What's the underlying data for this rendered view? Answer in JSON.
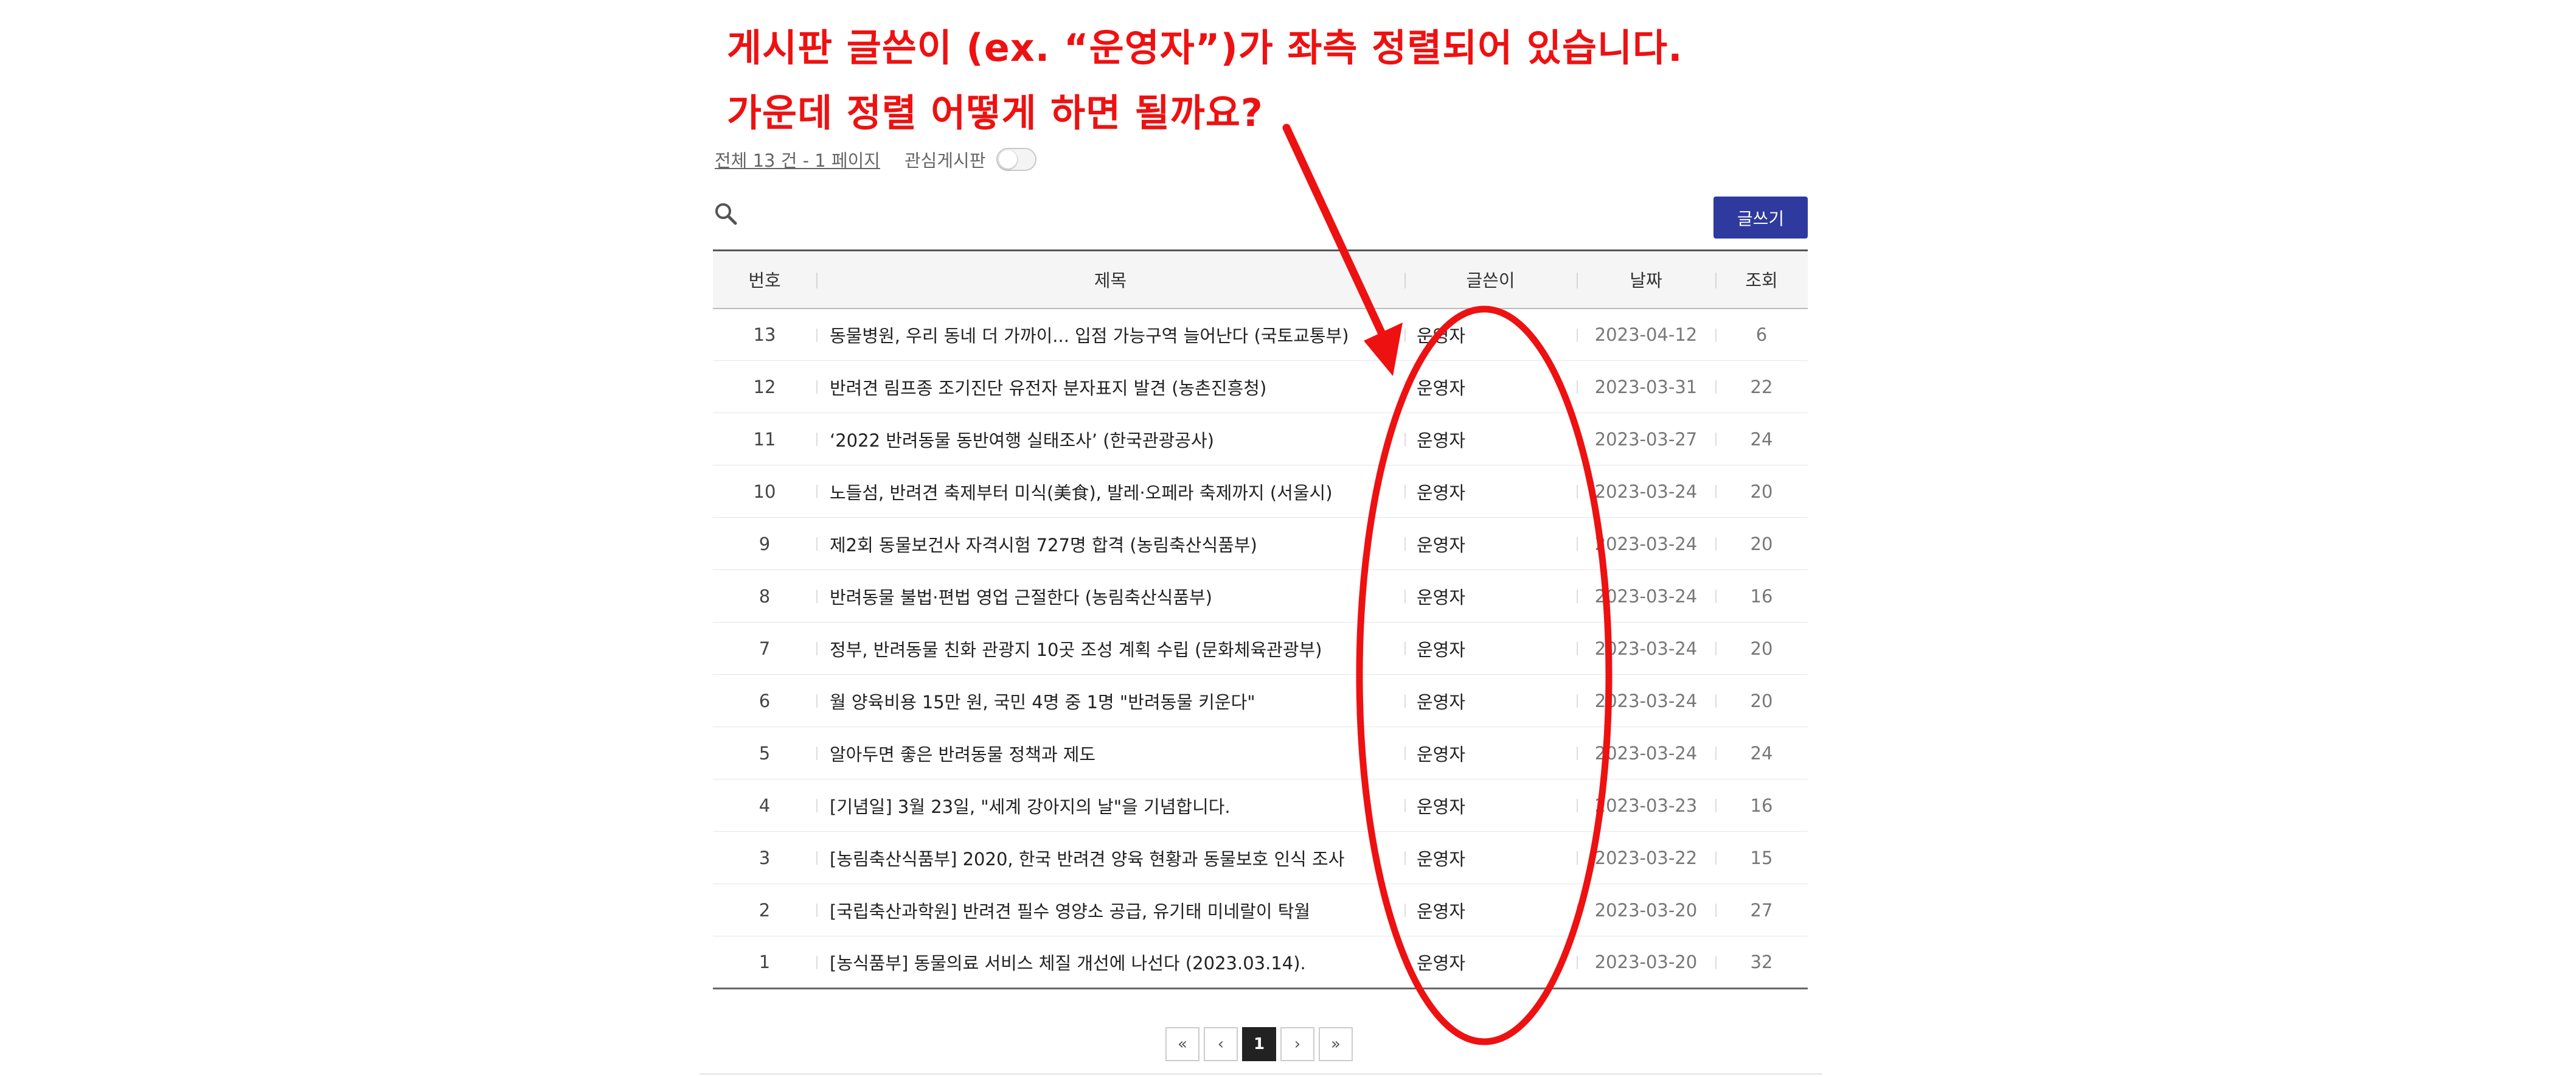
{
  "annotation": {
    "line1": "게시판 글쓴이 (ex. “운영자”)가  좌측  정렬되어 있습니다.",
    "line2": "가운데 정렬  어떻게 하면 될까요?"
  },
  "board_meta": {
    "count_text": "전체 13 건 - 1 페이지",
    "favorite_label": "관심게시판"
  },
  "toolbar": {
    "write_label": "글쓰기"
  },
  "table": {
    "headers": {
      "num": "번호",
      "title": "제목",
      "author": "글쓴이",
      "date": "날짜",
      "views": "조회"
    },
    "rows": [
      {
        "num": "13",
        "title": "동물병원, 우리 동네 더 가까이... 입점 가능구역 늘어난다 (국토교통부)",
        "author": "운영자",
        "date": "2023-04-12",
        "views": "6"
      },
      {
        "num": "12",
        "title": "반려견 림프종 조기진단 유전자 분자표지 발견 (농촌진흥청)",
        "author": "운영자",
        "date": "2023-03-31",
        "views": "22"
      },
      {
        "num": "11",
        "title": "‘2022 반려동물 동반여행 실태조사’ (한국관광공사)",
        "author": "운영자",
        "date": "2023-03-27",
        "views": "24"
      },
      {
        "num": "10",
        "title": "노들섬, 반려견 축제부터 미식(美食), 발레·오페라 축제까지 (서울시)",
        "author": "운영자",
        "date": "2023-03-24",
        "views": "20"
      },
      {
        "num": "9",
        "title": "제2회 동물보건사 자격시험 727명 합격 (농림축산식품부)",
        "author": "운영자",
        "date": "2023-03-24",
        "views": "20"
      },
      {
        "num": "8",
        "title": "반려동물 불법·편법 영업 근절한다 (농림축산식품부)",
        "author": "운영자",
        "date": "2023-03-24",
        "views": "16"
      },
      {
        "num": "7",
        "title": "정부, 반려동물 친화 관광지 10곳 조성 계획 수립 (문화체육관광부)",
        "author": "운영자",
        "date": "2023-03-24",
        "views": "20"
      },
      {
        "num": "6",
        "title": "월 양육비용 15만 원, 국민 4명 중 1명 \"반려동물 키운다\"",
        "author": "운영자",
        "date": "2023-03-24",
        "views": "20"
      },
      {
        "num": "5",
        "title": "알아두면 좋은 반려동물 정책과 제도",
        "author": "운영자",
        "date": "2023-03-24",
        "views": "24"
      },
      {
        "num": "4",
        "title": "[기념일] 3월 23일, \"세계 강아지의 날\"을 기념합니다.",
        "author": "운영자",
        "date": "2023-03-23",
        "views": "16"
      },
      {
        "num": "3",
        "title": "[농림축산식품부] 2020, 한국 반려견 양육 현황과 동물보호 인식 조사",
        "author": "운영자",
        "date": "2023-03-22",
        "views": "15"
      },
      {
        "num": "2",
        "title": "[국립축산과학원] 반려견 필수 영양소 공급, 유기태 미네랄이 탁월",
        "author": "운영자",
        "date": "2023-03-20",
        "views": "27"
      },
      {
        "num": "1",
        "title": "[농식품부] 동물의료 서비스 체질 개선에 나선다 (2023.03.14).",
        "author": "운영자",
        "date": "2023-03-20",
        "views": "32"
      }
    ]
  },
  "pagination": {
    "first": "«",
    "prev": "‹",
    "current": "1",
    "next": "›",
    "last": "»"
  },
  "colors": {
    "annotation": "#ee1111",
    "write_button": "#2e3a9e",
    "active_page": "#222222"
  },
  "icons": {
    "search": "search-icon",
    "annotation_arrow": "arrow-icon",
    "annotation_ellipse": "ellipse-highlight"
  }
}
